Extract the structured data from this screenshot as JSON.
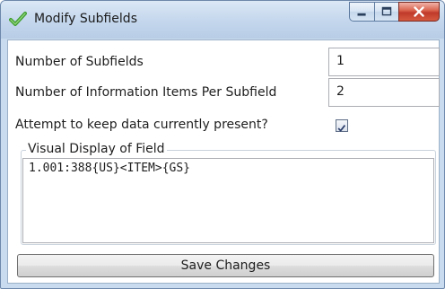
{
  "window": {
    "title": "Modify Subfields",
    "title_icon": "green-check-icon",
    "caption_buttons": [
      "minimize-icon",
      "maximize-icon",
      "close-icon"
    ]
  },
  "form": {
    "subfields_label": "Number of Subfields",
    "subfields_value": "1",
    "items_label": "Number of Information Items Per Subfield",
    "items_value": "2",
    "keep_data_label": "Attempt to keep data currently present?",
    "keep_data_checked": true
  },
  "visual_display": {
    "label": "Visual Display of Field",
    "text": "1.001:388{US}<ITEM>{GS}"
  },
  "actions": {
    "save_label": "Save Changes"
  },
  "colors": {
    "accent_check": "#3f9e2f",
    "close_button": "#c0392b",
    "window_frame": "#c9dbee"
  }
}
